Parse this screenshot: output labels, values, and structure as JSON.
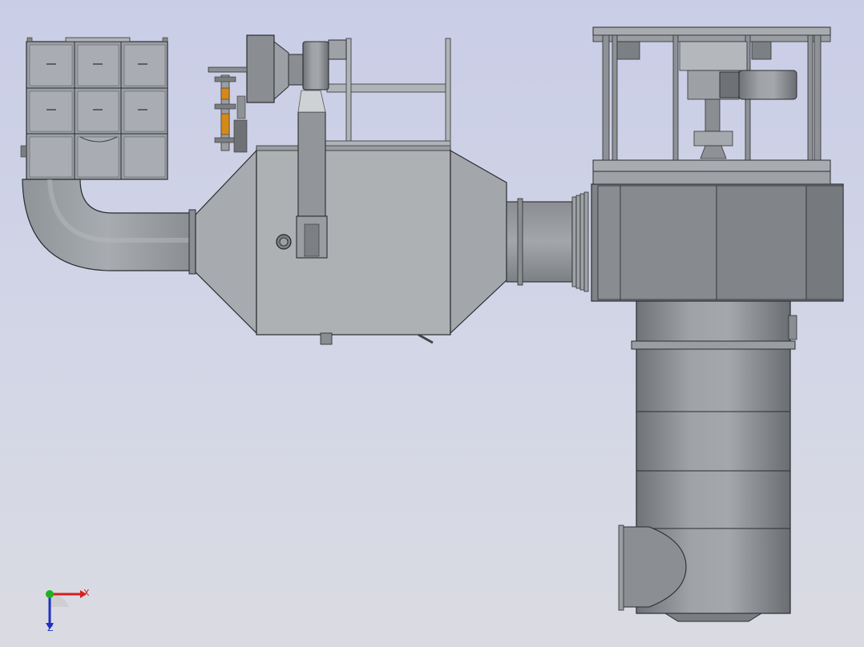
{
  "viewport": {
    "background_top": "#c9cde6",
    "background_bottom": "#dadbe2",
    "model_color": "#9a9fa4",
    "edge_color": "#2a2d30",
    "accent_orange": "#d48a1a"
  },
  "triad": {
    "x_label": "X",
    "z_label": "Z",
    "x_color": "#d42020",
    "y_color": "#20b020",
    "z_color": "#2030c0"
  }
}
